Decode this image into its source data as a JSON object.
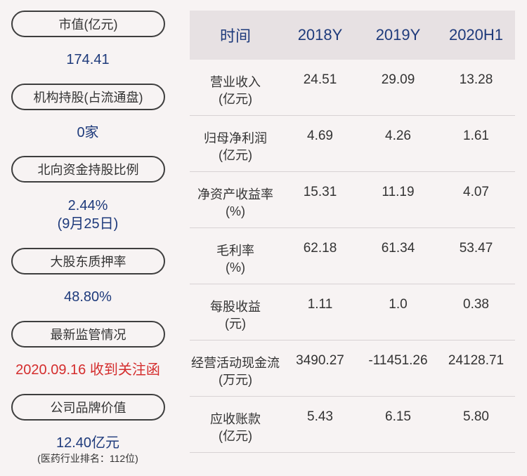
{
  "left_panel": {
    "items": [
      {
        "label": "市值(亿元)",
        "value": "174.41"
      },
      {
        "label": "机构持股(占流通盘)",
        "value": "0家"
      },
      {
        "label": "北向资金持股比例",
        "value": "2.44%",
        "value2": "(9月25日)"
      },
      {
        "label": "大股东质押率",
        "value": "48.80%"
      },
      {
        "label": "最新监管情况",
        "value": "2020.09.16 收到关注函",
        "value_color": "#d42d2d"
      },
      {
        "label": "公司品牌价值",
        "value": "12.40亿元",
        "note": "(医药行业排名：112位)"
      }
    ]
  },
  "table": {
    "headers": [
      "时间",
      "2018Y",
      "2019Y",
      "2020H1"
    ],
    "rows": [
      {
        "metric": "营业收入",
        "unit": "(亿元)",
        "values": [
          "24.51",
          "29.09",
          "13.28"
        ]
      },
      {
        "metric": "归母净利润",
        "unit": "(亿元)",
        "values": [
          "4.69",
          "4.26",
          "1.61"
        ]
      },
      {
        "metric": "净资产收益率",
        "unit": "(%)",
        "values": [
          "15.31",
          "11.19",
          "4.07"
        ]
      },
      {
        "metric": "毛利率",
        "unit": "(%)",
        "values": [
          "62.18",
          "61.34",
          "53.47"
        ]
      },
      {
        "metric": "每股收益",
        "unit": "(元)",
        "values": [
          "1.11",
          "1.0",
          "0.38"
        ]
      },
      {
        "metric": "经营活动现金流",
        "unit": "(万元)",
        "values": [
          "3490.27",
          "-11451.26",
          "24128.71"
        ]
      },
      {
        "metric": "应收账款",
        "unit": "(亿元)",
        "values": [
          "5.43",
          "6.15",
          "5.80"
        ]
      }
    ]
  },
  "colors": {
    "background": "#f7f3f3",
    "header_bg": "#e7e1e3",
    "value_blue": "#1e3a7b",
    "alert_red": "#d42d2d"
  }
}
